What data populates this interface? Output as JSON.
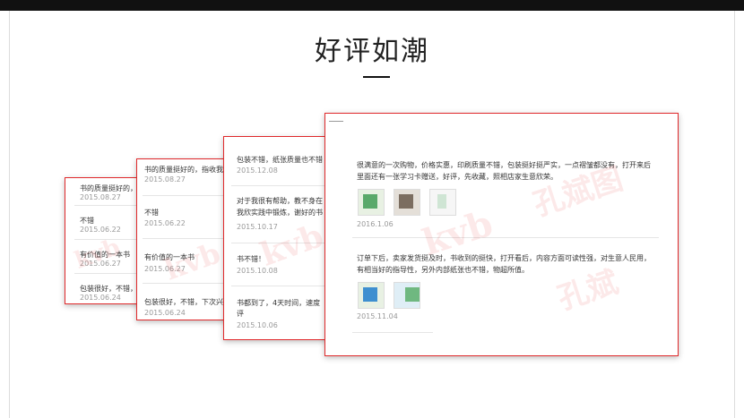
{
  "header": {
    "title": "好评如潮"
  },
  "watermark": {
    "logo": "kvb",
    "brand": "孔斌图",
    "stamp": "孔斌"
  },
  "cards": {
    "c1": {
      "reviews": [
        {
          "text": "书的质量挺好的，指收",
          "date": "2015.08.27"
        },
        {
          "text": "不错",
          "date": "2015.06.22"
        },
        {
          "text": "有价值的一本书",
          "date": "2015.06.27"
        },
        {
          "text": "包装很好，不错，下次",
          "date": "2015.06.24"
        }
      ]
    },
    "c2": {
      "reviews": [
        {
          "text": "书的质量挺好的，指收我",
          "date": "2015.08.27"
        },
        {
          "text": "不错",
          "date": "2015.06.22"
        },
        {
          "text": "有价值的一本书",
          "date": "2015.06.27"
        },
        {
          "text": "包装很好，不错，下次兴",
          "date": "2015.06.24"
        }
      ]
    },
    "c3": {
      "reviews": [
        {
          "text": "包装不错，纸张质量也不错",
          "date": "2015.12.08"
        },
        {
          "text": "对于我很有帮助，教不身在",
          "text2": "我欣实践中锻炼，谢好的书",
          "date": "2015.10.17"
        },
        {
          "text": "书不错！",
          "date": "2015.10.08"
        },
        {
          "text": "书都到了，4天时间，速度",
          "text2": "评",
          "date": "2015.10.06"
        }
      ]
    },
    "c4": {
      "reviews": [
        {
          "text": "很满意的一次购物，价格实惠，印刷质量不错，包装挺好挺严实，一点褶皱都没有，打开来后",
          "text2": "里面还有一张学习卡赠送，好评，先收藏，照相店家生意欣荣。",
          "date": "2016.1.06"
        },
        {
          "text": "订单下后，卖家发货挺及时，书收到的挺快，打开看后，内容方面可读性强，对生意人民用，",
          "text2": "有相当好的指导性，另外内部纸张也不错，物超所值。",
          "date": "2015.11.04"
        }
      ]
    }
  }
}
